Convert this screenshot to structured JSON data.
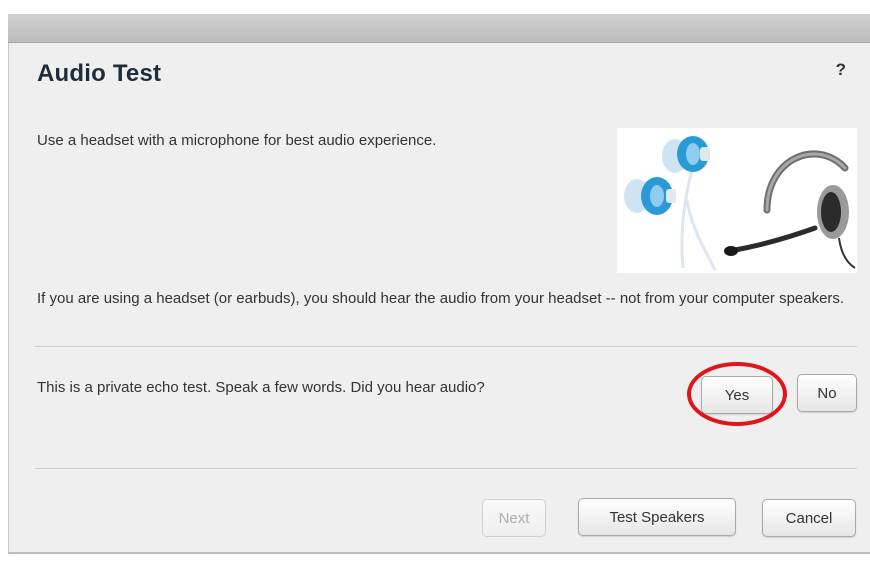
{
  "dialog": {
    "title": "Audio Test",
    "help_label": "?",
    "intro_text": "Use a headset with a microphone for best audio experience.",
    "headset_text": "If you are using a headset (or earbuds), you should hear the audio from your headset -- not from your computer speakers.",
    "echo_text": "This is a private echo test.  Speak a few words.  Did you hear audio?",
    "image_icons": [
      "earbuds-icon",
      "headset-icon"
    ]
  },
  "answer_buttons": {
    "yes_label": "Yes",
    "no_label": "No"
  },
  "footer": {
    "next_label": "Next",
    "test_speakers_label": "Test Speakers",
    "cancel_label": "Cancel"
  },
  "colors": {
    "highlight_ring": "#e0141a",
    "earbud_blue": "#2a9ad6",
    "title_color": "#1f2d3a"
  }
}
